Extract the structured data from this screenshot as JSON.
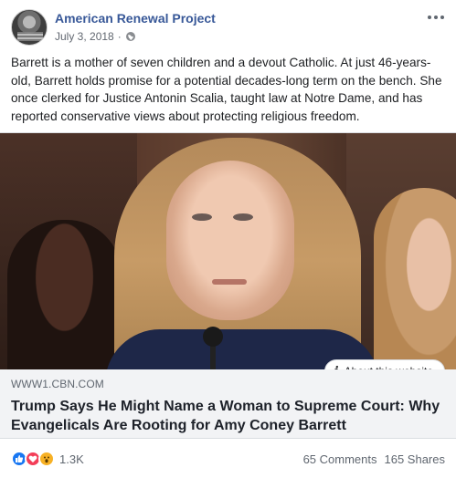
{
  "post": {
    "page_name": "American Renewal Project",
    "date": "July 3, 2018",
    "separator": "·",
    "body": "Barrett is a mother of seven children and a devout Catholic. At just 46-years-old, Barrett holds promise for a potential decades-long term on the bench. She once clerked for Justice Antonin Scalia, taught law at Notre Dame, and has reported conservative views about protecting religious freedom."
  },
  "link": {
    "domain": "WWW1.CBN.COM",
    "headline": "Trump Says He Might Name a Woman to Supreme Court: Why Evangelicals Are Rooting for Amy Coney Barrett",
    "about_label": "About this website",
    "about_icon": "i"
  },
  "footer": {
    "reaction_icons": [
      "like-icon",
      "love-icon",
      "wow-icon"
    ],
    "reaction_count": "1.3K",
    "comments": "65 Comments",
    "shares": "165 Shares"
  },
  "colors": {
    "page_name": "#385898",
    "like": "#1877f2",
    "love": "#f33e58",
    "wow": "#f7b125",
    "link_bg": "#f2f3f5"
  }
}
